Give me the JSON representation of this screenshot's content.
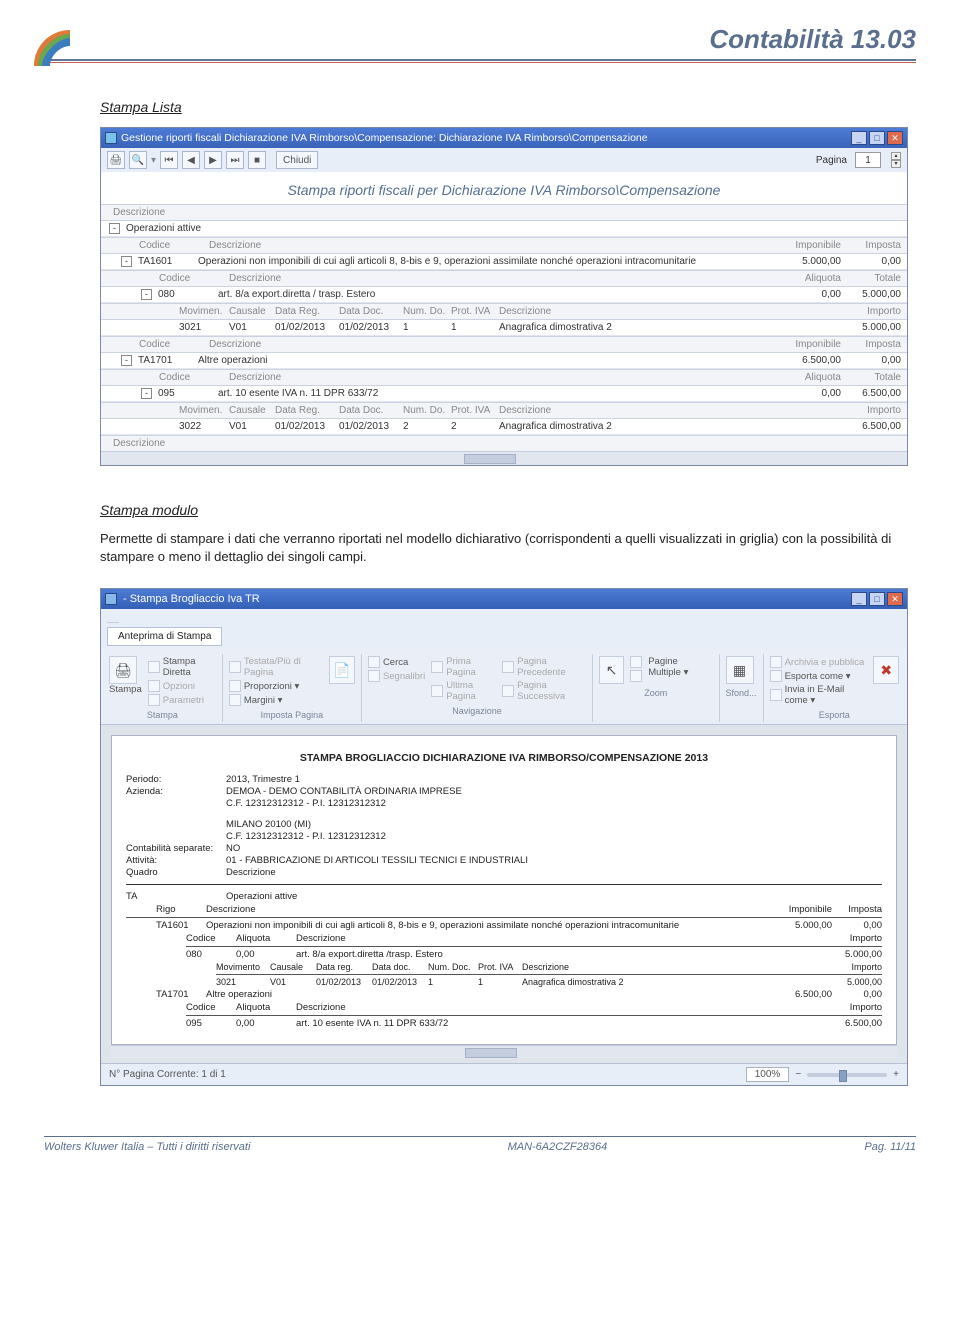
{
  "header": {
    "title": "Contabilità 13.03"
  },
  "section1_heading": "Stampa Lista",
  "section2_heading": "Stampa modulo",
  "body_text": "Permette di stampare i dati che verranno riportati nel modello dichiarativo (corrispondenti a quelli visualizzati in griglia) con la possibilità di stampare o meno il dettaglio dei singoli campi.",
  "screenshot1": {
    "titlebar": "Gestione riporti fiscali Dichiarazione IVA Rimborso\\Compensazione: Dichiarazione IVA Rimborso\\Compensazione",
    "toolbar": {
      "chiudi": "Chiudi",
      "pagina_label": "Pagina",
      "pagina_value": "1"
    },
    "report_title": "Stampa riporti fiscali per Dichiarazione IVA Rimborso\\Compensazione",
    "rows": {
      "descr_hdr": "Descrizione",
      "op_attive": "Operazioni attive",
      "hdr1": {
        "c1": "Codice",
        "c2": "Descrizione",
        "c3": "Imponibile",
        "c4": "Imposta"
      },
      "r1": {
        "expand": "-",
        "code": "TA1601",
        "desc": "Operazioni non imponibili di cui agli articoli 8, 8-bis e 9, operazioni assimilate nonché operazioni intracomunitarie",
        "imp": "5.000,00",
        "tax": "0,00"
      },
      "hdr2": {
        "c1": "Codice",
        "c2": "Descrizione",
        "c3": "Aliquota",
        "c4": "Totale"
      },
      "r2": {
        "expand": "-",
        "code": "080",
        "desc": "art. 8/a export.diretta / trasp. Estero",
        "al": "0,00",
        "tot": "5.000,00"
      },
      "hdr3": {
        "c1": "Movimen.",
        "c2": "Causale",
        "c3": "Data Reg.",
        "c4": "Data Doc.",
        "c5": "Num. Do.",
        "c6": "Prot. IVA",
        "c7": "Descrizione",
        "c8": "Importo"
      },
      "r3": {
        "mov": "3021",
        "cau": "V01",
        "dreg": "01/02/2013",
        "ddoc": "01/02/2013",
        "num": "1",
        "prot": "1",
        "desc": "Anagrafica dimostrativa 2",
        "imp": "5.000,00"
      },
      "hdr4": {
        "c1": "Codice",
        "c2": "Descrizione",
        "c3": "Imponibile",
        "c4": "Imposta"
      },
      "r4": {
        "expand": "-",
        "code": "TA1701",
        "desc": "Altre operazioni",
        "imp": "6.500,00",
        "tax": "0,00"
      },
      "hdr5": {
        "c1": "Codice",
        "c2": "Descrizione",
        "c3": "Aliquota",
        "c4": "Totale"
      },
      "r5": {
        "expand": "-",
        "code": "095",
        "desc": "art. 10 esente IVA n. 11 DPR 633/72",
        "al": "0,00",
        "tot": "6.500,00"
      },
      "hdr6": {
        "c1": "Movimen.",
        "c2": "Causale",
        "c3": "Data Reg.",
        "c4": "Data Doc.",
        "c5": "Num. Do.",
        "c6": "Prot. IVA",
        "c7": "Descrizione",
        "c8": "Importo"
      },
      "r6": {
        "mov": "3022",
        "cau": "V01",
        "dreg": "01/02/2013",
        "ddoc": "01/02/2013",
        "num": "2",
        "prot": "2",
        "desc": "Anagrafica dimostrativa 2",
        "imp": "6.500,00"
      },
      "descr_hdr2": "Descrizione"
    }
  },
  "screenshot2": {
    "titlebar": "- Stampa Brogliaccio Iva TR",
    "ribbon_tab": "Anteprima di Stampa",
    "groups": {
      "stampa": {
        "big": "Stampa",
        "diretta": "Stampa Diretta",
        "opzioni": "Opzioni",
        "parametri": "Parametri",
        "label": "Stampa"
      },
      "imposta": {
        "testata": "Testata/Più di Pagina",
        "proporzioni": "Proporzioni ▾",
        "margini": "Margini ▾",
        "label": "Imposta Pagina"
      },
      "nav": {
        "cerca": "Cerca",
        "segnalibri": "Segnalibri",
        "prima": "Prima Pagina",
        "prec": "Pagina Precedente",
        "succ": "Pagina Successiva",
        "ultima": "Ultima Pagina",
        "label": "Navigazione"
      },
      "zoom": {
        "pagine": "Pagine Multiple ▾",
        "label": "Zoom"
      },
      "sfondo": {
        "label": "Sfond..."
      },
      "esporta": {
        "archivia": "Archivia e pubblica",
        "esporta": "Esporta come ▾",
        "email": "Invia in E-Mail come ▾",
        "label": "Esporta"
      }
    },
    "report": {
      "title": "STAMPA BROGLIACCIO DICHIARAZIONE IVA RIMBORSO/COMPENSAZIONE 2013",
      "periodo_k": "Periodo:",
      "periodo_v": "2013, Trimestre 1",
      "azienda_k": "Azienda:",
      "azienda_v": "DEMOA - DEMO CONTABILITÀ ORDINARIA IMPRESE",
      "cf1": "C.F. 12312312312 - P.I. 12312312312",
      "addr": "MILANO 20100 (MI)",
      "cf2": "C.F. 12312312312 - P.I. 12312312312",
      "contsep_k": "Contabilità separate:",
      "contsep_v": "NO",
      "attivita_k": "Attività:",
      "attivita_v": "01 - FABBRICAZIONE DI ARTICOLI TESSILI TECNICI E INDUSTRIALI",
      "quadro_k": "Quadro",
      "quadro_v": "Descrizione",
      "tx": "TA",
      "tx_desc": "Operazioni attive",
      "col_rigo": "Rigo",
      "col_desc": "Descrizione",
      "col_imp": "Imponibile",
      "col_tax": "Imposta",
      "row_ta1601_code": "TA1601",
      "row_ta1601_desc": "Operazioni non imponibili di cui agli articoli 8, 8-bis e 9, operazioni assimilate nonché operazioni intracomunitarie",
      "row_ta1601_imp": "5.000,00",
      "row_ta1601_tax": "0,00",
      "sub_cod": "Codice",
      "sub_aliq": "Aliquota",
      "sub_desc": "Descrizione",
      "sub_imp": "Importo",
      "row_080_code": "080",
      "row_080_al": "0,00",
      "row_080_desc": "art. 8/a export.diretta /trasp. Estero",
      "row_080_imp": "5.000,00",
      "mov_mov": "Movimento",
      "mov_cau": "Causale",
      "mov_dreg": "Data reg.",
      "mov_ddoc": "Data doc.",
      "mov_num": "Num. Doc.",
      "mov_prot": "Prot. IVA",
      "mov_desc": "Descrizione",
      "mov_imp": "Importo",
      "row_mov_3021": "3021",
      "row_mov_v01": "V01",
      "row_mov_dr": "01/02/2013",
      "row_mov_dd": "01/02/2013",
      "row_mov_n": "1",
      "row_mov_p": "1",
      "row_mov_desc": "Anagrafica dimostrativa 2",
      "row_mov_imp": "5.000,00",
      "row_ta1701_code": "TA1701",
      "row_ta1701_desc": "Altre operazioni",
      "row_ta1701_imp": "6.500,00",
      "row_ta1701_tax": "0,00",
      "row_095_code": "095",
      "row_095_al": "0,00",
      "row_095_desc": "art. 10 esente IVA n. 11 DPR 633/72",
      "row_095_imp": "6.500,00"
    },
    "status": {
      "page": "N° Pagina Corrente: 1 di 1",
      "zoom": "100%"
    }
  },
  "footer": {
    "left": "Wolters Kluwer Italia – Tutti i diritti riservati",
    "center": "MAN-6A2CZF28364",
    "right": "Pag. 11/11"
  }
}
